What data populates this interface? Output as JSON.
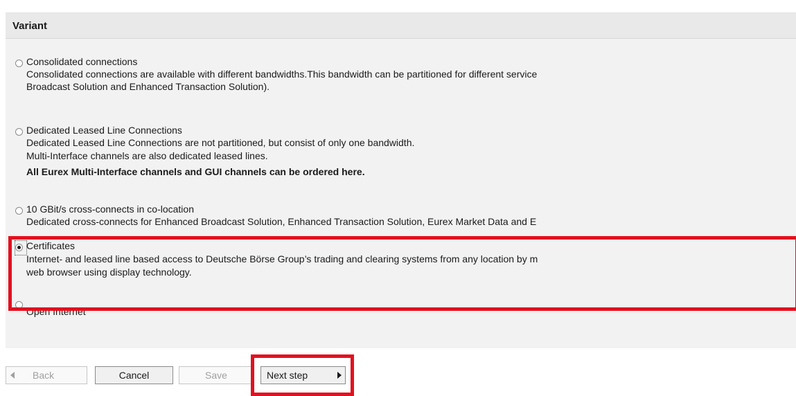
{
  "section": {
    "title": "Variant"
  },
  "options": [
    {
      "title": "Consolidated connections",
      "lines": [
        "Consolidated connections are available with different bandwidths.This bandwidth can be partitioned for different service",
        "Broadcast Solution and Enhanced Transaction Solution)."
      ],
      "selected": false
    },
    {
      "title": "Dedicated Leased Line Connections",
      "lines": [
        "Dedicated Leased Line Connections are not partitioned, but consist of only one bandwidth.",
        "Multi-Interface channels are also dedicated leased lines."
      ],
      "bold_note": "All Eurex Multi-Interface channels and GUI channels can be ordered here.",
      "selected": false
    },
    {
      "title": "10 GBit/s cross-connects in co-location",
      "lines": [
        "Dedicated cross-connects for Enhanced Broadcast Solution, Enhanced Transaction Solution, Eurex Market Data and E"
      ],
      "selected": false
    },
    {
      "title": "Certificates",
      "lines": [
        "Internet- and leased line based access to Deutsche Börse Group’s trading and clearing systems from any location by m",
        "web browser using display technology."
      ],
      "selected": true
    },
    {
      "title": "Open Internet",
      "lines": [],
      "selected": false
    }
  ],
  "toolbar": {
    "back_label": "Back",
    "cancel_label": "Cancel",
    "save_label": "Save",
    "next_label": "Next step"
  },
  "colors": {
    "highlight": "#e3101f",
    "panel_bg": "#f2f2f2",
    "header_bg": "#e9e9e9"
  },
  "icons": {
    "back": "chevron-left-icon",
    "next": "chevron-right-icon"
  }
}
